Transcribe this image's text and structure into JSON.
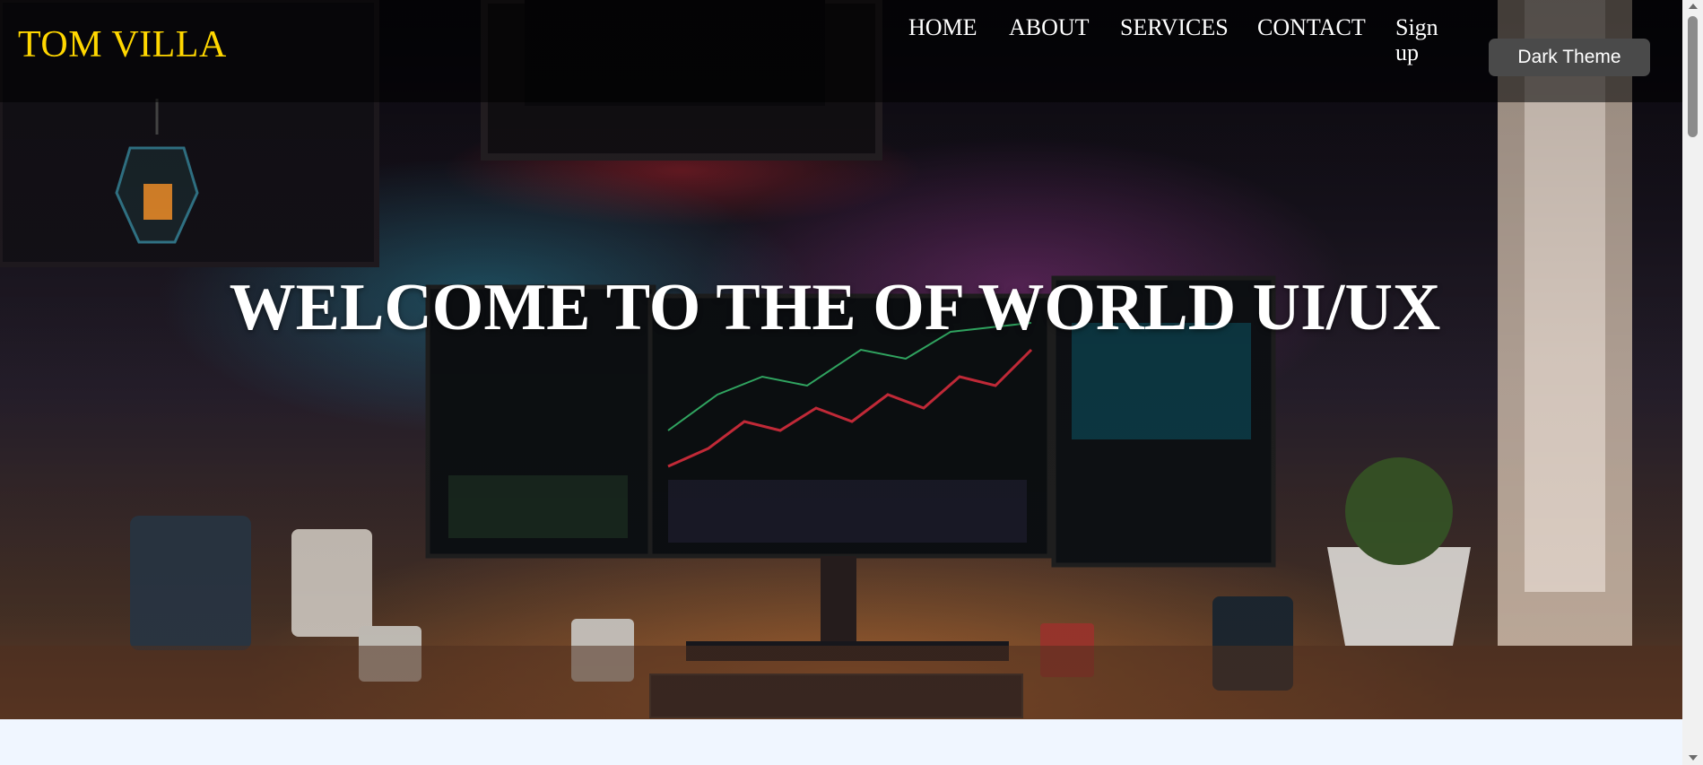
{
  "brand": {
    "logo_text": "TOM VILLA",
    "logo_color": "#ffd700"
  },
  "nav": {
    "items": [
      {
        "label": "HOME"
      },
      {
        "label": "ABOUT"
      },
      {
        "label": "SERVICES"
      },
      {
        "label": "CONTACT"
      },
      {
        "label": "Sign up"
      }
    ],
    "theme_toggle_label": "Dark Theme"
  },
  "hero": {
    "headline": "WELCOME TO THE OF WORLD UI/UX",
    "background_image": "desk-workspace-illustration"
  },
  "colors": {
    "page_background": "#f0f6ff",
    "nav_text": "#ffffff",
    "button_background": "#4a4a4a"
  }
}
